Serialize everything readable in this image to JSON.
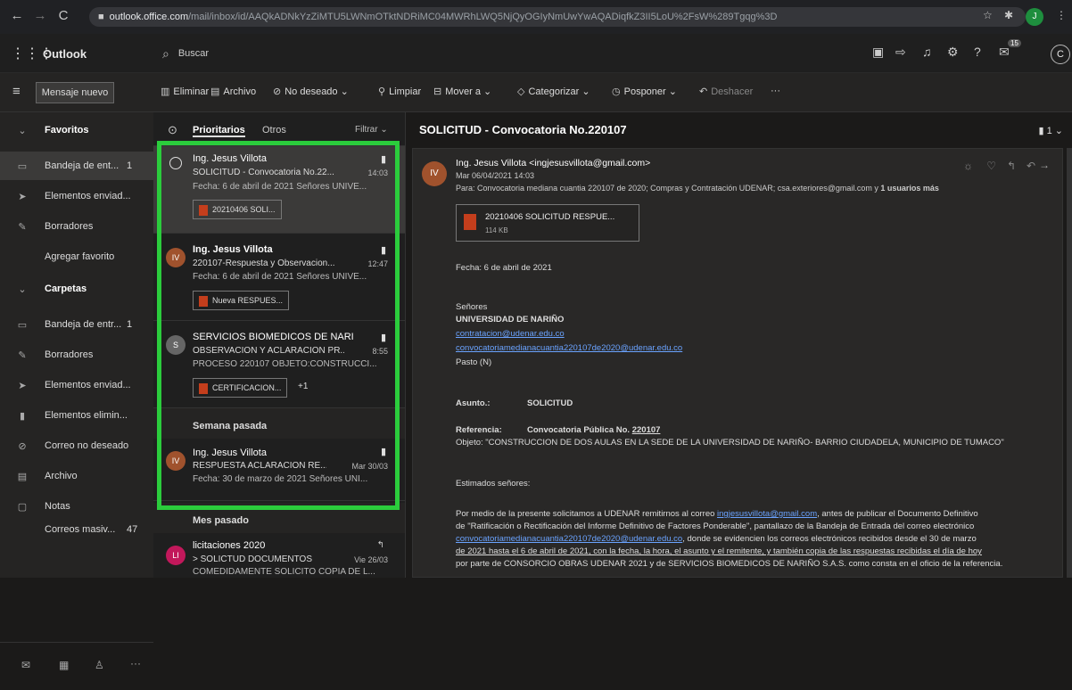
{
  "browser": {
    "url_host": "outlook.office.com",
    "url_path": "/mail/inbox/id/AAQkADNkYzZiMTU5LWNmOTktNDRiMC04MWRhLWQ5NjQyOGIyNmUwYwAQADiqfkZ3II5LoU%2FsW%289Tgqg%3D",
    "user_initial": "J"
  },
  "header": {
    "app": "Outlook",
    "search_placeholder": "Buscar",
    "badge": "15",
    "account_initial": "C"
  },
  "command": {
    "new": "Mensaje nuevo",
    "delete": "Eliminar",
    "archive": "Archivo",
    "junk": "No deseado",
    "sweep": "Limpiar",
    "move": "Mover a",
    "categorize": "Categorizar",
    "snooze": "Posponer",
    "undo": "Deshacer",
    "more": "···"
  },
  "nav": {
    "favorites": "Favoritos",
    "inbox_fav": "Bandeja de ent...",
    "inbox_fav_count": "1",
    "sent_fav": "Elementos enviad...",
    "drafts_fav": "Borradores",
    "add_fav": "Agregar favorito",
    "folders": "Carpetas",
    "inbox": "Bandeja de entr...",
    "inbox_count": "1",
    "drafts": "Borradores",
    "sent": "Elementos enviad...",
    "deleted": "Elementos elimin...",
    "junk": "Correo no deseado",
    "archive": "Archivo",
    "notes": "Notas",
    "mass": "Correos masiv...",
    "mass_count": "47"
  },
  "list": {
    "focused": "Prioritarios",
    "other": "Otros",
    "filter": "Filtrar",
    "messages": [
      {
        "from": "Ing. Jesus Villota",
        "subject": "SOLICITUD - Convocatoria No.22...",
        "time": "14:03",
        "preview": "Fecha: 6 de abril de 2021 Señores UNIVE...",
        "attach": "20210406 SOLI..."
      },
      {
        "initials": "IV",
        "from": "Ing. Jesus Villota",
        "subject": "220107-Respuesta y Observacion...",
        "time": "12:47",
        "preview": "Fecha: 6 de abril de 2021 Señores UNIVE...",
        "attach": "Nueva RESPUES..."
      },
      {
        "initials": "S",
        "from": "SERVICIOS BIOMEDICOS DE NARI...",
        "subject": "OBSERVACION Y ACLARACION PR...",
        "time": "8:55",
        "preview": "PROCESO 220107 OBJETO:CONSTRUCCI...",
        "attach": "CERTIFICACION...",
        "extra": "+1"
      },
      {
        "initials": "IV",
        "from": "Ing. Jesus Villota",
        "subject": "RESPUESTA ACLARACION RE...",
        "time": "Mar 30/03",
        "preview": "Fecha: 30 de marzo de 2021 Señores UNI..."
      },
      {
        "initials": "LI",
        "from": "licitaciones 2020",
        "subject": "> SOLICTUD DOCUMENTOS",
        "time": "Vie 26/03",
        "preview": "COMEDIDAMENTE SOLICITO COPIA DE L..."
      }
    ],
    "group_lastweek": "Semana pasada",
    "group_lastmonth": "Mes pasado"
  },
  "reading": {
    "title": "SOLICITUD - Convocatoria No.220107",
    "count": "1",
    "initials": "IV",
    "sender": "Ing. Jesus Villota <ingjesusvillota@gmail.com>",
    "date": "Mar 06/04/2021 14:03",
    "to_label": "Para:",
    "to": "Convocatoria mediana cuantia 220107 de 2020; Compras y Contratación UDENAR; csa.exteriores@gmail.com y",
    "to_more": "1 usuarios más",
    "att_name": "20210406 SOLICITUD RESPUE...",
    "att_size": "114 KB",
    "l_fecha": "Fecha: 6 de abril de 2021",
    "l_senores": "Señores",
    "l_uni": "UNIVERSIDAD DE NARIÑO",
    "l_mail1": "contratacion@udenar.edu.co",
    "l_mail2": "convocatoriamedianacuantia220107de2020@udenar.edu.co",
    "l_pasto": "Pasto (N)",
    "l_asunto_k": "Asunto.:",
    "l_asunto_v": "SOLICITUD",
    "l_ref_k": "Referencia:",
    "l_ref_v": "Convocatoria Pública No. ",
    "l_ref_num": "220107",
    "l_objeto": "Objeto: \"CONSTRUCCION DE DOS AULAS EN LA SEDE DE LA UNIVERSIDAD DE NARIÑO- BARRIO CIUDADELA, MUNICIPIO DE TUMACO\"",
    "l_estimados": "Estimados señores:",
    "p1a": "Por medio de la presente solicitamos a UDENAR remitirnos al correo ",
    "p1link": "ingjesusvillota@gmail.com",
    "p1b": ", antes de publicar el Documento Definitivo",
    "p2": "de \"Ratificación o Rectificación del Informe Definitivo de Factores Ponderable\", pantallazo de la Bandeja de Entrada del correo electrónico",
    "p3link": "convocatoriamedianacuantia220107de2020@udenar.edu.co",
    "p3b": ", donde se evidencien los correos electrónicos recibidos desde el 30 de marzo",
    "p4": "de 2021 hasta el 6 de abril de 2021, con la fecha, la hora, el asunto y el remitente, y también copia de las respuestas recibidas el día de hoy",
    "p5": "por parte de CONSORCIO OBRAS UDENAR 2021 y de SERVICIOS BIOMEDICOS DE NARIÑO S.A.S. como consta en el oficio de la referencia."
  },
  "colors": {
    "highlight": "#2bcc3c",
    "accent": "#6aa3ff"
  }
}
